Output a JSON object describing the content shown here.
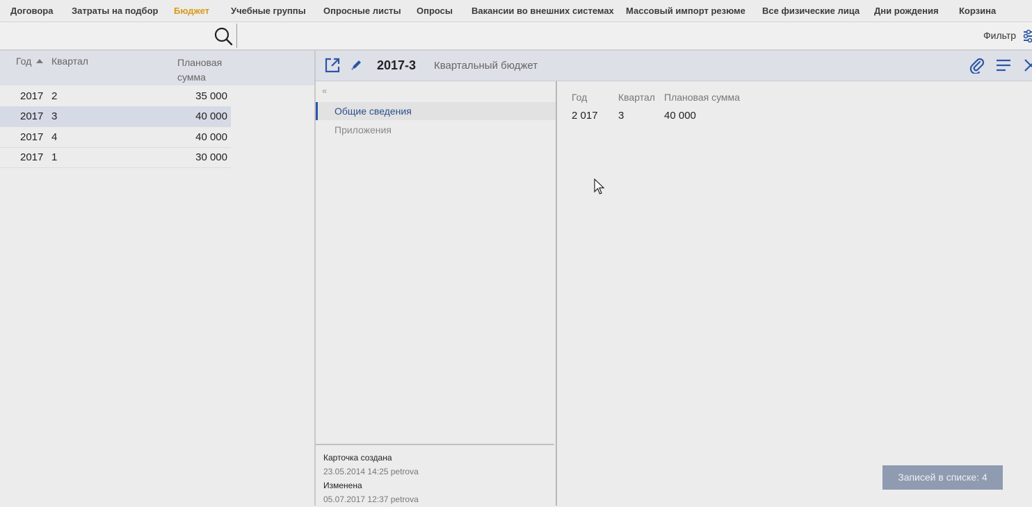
{
  "nav": {
    "tabs": [
      {
        "label": "Договора"
      },
      {
        "label": "Затраты на подбор"
      },
      {
        "label": "Бюджет",
        "active": true
      },
      {
        "label": "Учебные группы"
      },
      {
        "label": "Опросные листы"
      },
      {
        "label": "Опросы"
      },
      {
        "label": "Вакансии во внешних системах"
      },
      {
        "label": "Массовый импорт резюме"
      },
      {
        "label": "Все физические лица"
      },
      {
        "label": "Дни рождения"
      },
      {
        "label": "Корзина"
      }
    ]
  },
  "toolbar": {
    "filter_label": "Фильтр",
    "search_icon": "search-icon",
    "filter_icon": "sliders-icon"
  },
  "list": {
    "columns": {
      "year": "Год",
      "quarter": "Квартал",
      "sum": "Плановая сумма"
    },
    "sort": {
      "column": "year",
      "direction": "asc"
    },
    "rows": [
      {
        "year": "2017",
        "quarter": "2",
        "sum": "35 000"
      },
      {
        "year": "2017",
        "quarter": "3",
        "sum": "40 000",
        "selected": true
      },
      {
        "year": "2017",
        "quarter": "4",
        "sum": "40 000"
      },
      {
        "year": "2017",
        "quarter": "1",
        "sum": "30 000"
      }
    ]
  },
  "record": {
    "title": "2017-3",
    "subtitle": "Квартальный бюджет",
    "icons": [
      "open-external-icon",
      "edit-pencil-icon",
      "attachment-icon",
      "menu-icon",
      "close-icon"
    ],
    "nav_items": [
      {
        "label": "Общие сведения",
        "active": true
      },
      {
        "label": "Приложения"
      }
    ],
    "collapse_glyph": "«",
    "audit": {
      "created_label": "Карточка создана",
      "created_value": "23.05.2014  14:25  petrova",
      "modified_label": "Изменена",
      "modified_value": "05.07.2017  12:37  petrova"
    },
    "fields": {
      "year_label": "Год",
      "year_value": "2 017",
      "quarter_label": "Квартал",
      "quarter_value": "3",
      "sum_label": "Плановая сумма",
      "sum_value": "40 000"
    }
  },
  "footer": {
    "count_label": "Записей в списке: 4"
  },
  "colors": {
    "active_tab": "#d99a1b",
    "accent": "#2a56a6",
    "selected_row": "#d6d9e6",
    "header_bg": "#dee0e8",
    "count_badge": "#8e9bb1"
  }
}
